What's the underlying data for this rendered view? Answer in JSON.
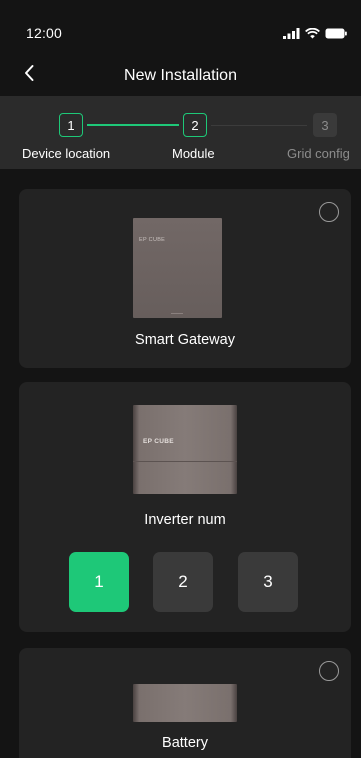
{
  "status_bar": {
    "time": "12:00",
    "icons": [
      "signal-icon",
      "wifi-icon",
      "battery-icon"
    ]
  },
  "nav": {
    "title": "New Installation",
    "back_icon": "chevron-left-icon"
  },
  "stepper": {
    "steps": [
      {
        "number": "1",
        "label": "Device location",
        "state": "done"
      },
      {
        "number": "2",
        "label": "Module",
        "state": "current"
      },
      {
        "number": "3",
        "label": "Grid config",
        "state": "pending"
      }
    ]
  },
  "cards": {
    "gateway": {
      "label": "Smart Gateway",
      "brand": "EP CUBE",
      "selected": false
    },
    "inverter": {
      "label": "Inverter num",
      "brand": "EP CUBE",
      "options": [
        "1",
        "2",
        "3"
      ],
      "selected_option": "1"
    },
    "battery": {
      "label": "Battery",
      "selected": false
    }
  },
  "colors": {
    "accent": "#1ec878",
    "background": "#141414",
    "card": "#232323",
    "stepper_bg": "#2b2b2b"
  }
}
